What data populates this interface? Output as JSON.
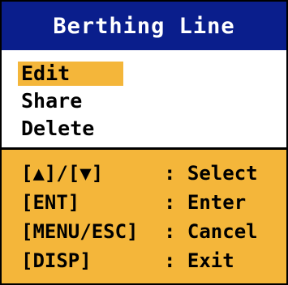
{
  "dialog": {
    "title": "Berthing Line"
  },
  "menu": {
    "items": [
      {
        "label": "Edit",
        "selected": true
      },
      {
        "label": "Share",
        "selected": false
      },
      {
        "label": "Delete",
        "selected": false
      }
    ]
  },
  "help": {
    "rows": [
      {
        "key": "[▲]/[▼]",
        "action": ": Select"
      },
      {
        "key": "[ENT]",
        "action": ": Enter"
      },
      {
        "key": "[MENU/ESC]",
        "action": ": Cancel"
      },
      {
        "key": "[DISP]",
        "action": ": Exit"
      }
    ]
  },
  "colors": {
    "title_bg": "#0a1e8c",
    "highlight": "#f4b63a",
    "help_bg": "#f4b63a"
  }
}
